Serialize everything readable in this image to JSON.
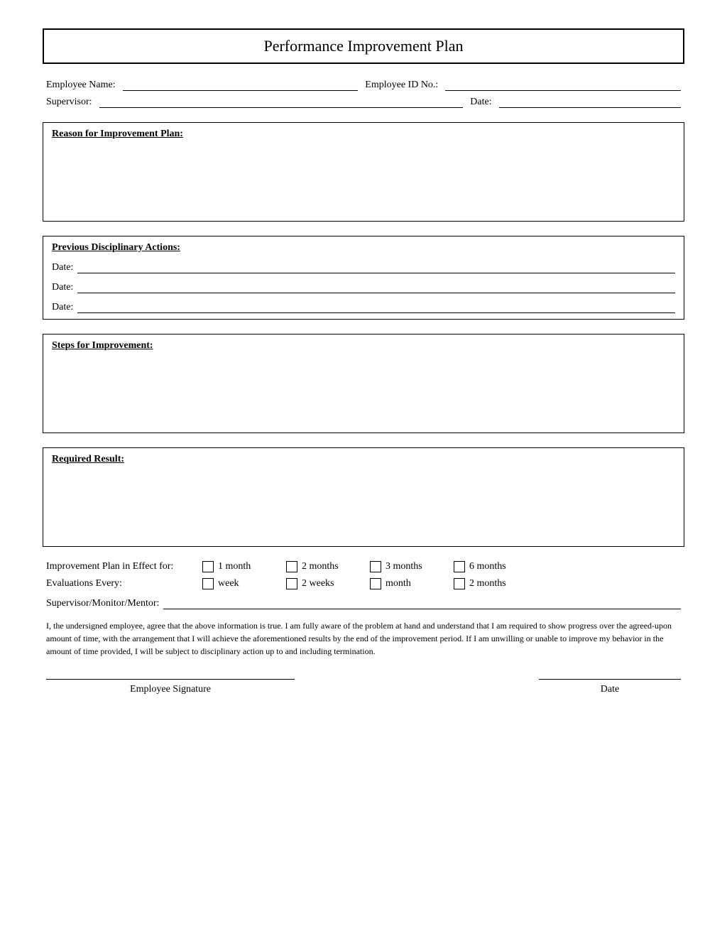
{
  "title": "Performance Improvement Plan",
  "header": {
    "employee_name_label": "Employee Name:",
    "employee_id_label": "Employee ID No.:",
    "supervisor_label": "Supervisor:",
    "date_label": "Date:"
  },
  "sections": {
    "reason": {
      "title": "Reason for Improvement Plan:"
    },
    "disciplinary": {
      "title": "Previous Disciplinary Actions:",
      "date_label_1": "Date:",
      "date_label_2": "Date:",
      "date_label_3": "Date:"
    },
    "steps": {
      "title": "Steps for Improvement:"
    },
    "result": {
      "title": "Required Result:"
    }
  },
  "effect_for": {
    "label": "Improvement Plan in Effect for:",
    "options": [
      "1 month",
      "2 months",
      "3 months",
      "6 months"
    ]
  },
  "evaluations": {
    "label": "Evaluations Every:",
    "options": [
      "week",
      "2 weeks",
      "month",
      "2 months"
    ]
  },
  "supervisor_monitor": {
    "label": "Supervisor/Monitor/Mentor:"
  },
  "agreement": "I, the undersigned employee, agree that the above information is true. I am fully aware of the problem at hand and understand that I am required to show progress over the agreed-upon amount of time, with the arrangement that I will achieve the aforementioned results by the end of the improvement period. If I am unwilling or unable to improve my behavior in the amount of time provided, I will be subject to disciplinary action up to and including termination.",
  "signature": {
    "employee_label": "Employee Signature",
    "date_label": "Date"
  }
}
